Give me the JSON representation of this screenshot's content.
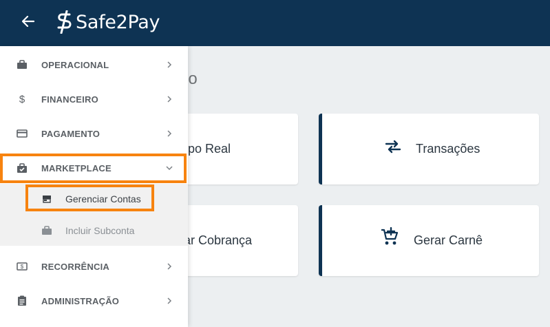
{
  "app": {
    "logo_text": "Safe2Pay"
  },
  "page": {
    "title_fragment": "do"
  },
  "cards": [
    {
      "label": "mpo Real",
      "icon": "clock-icon"
    },
    {
      "label": "Transações",
      "icon": "swap-arrows-icon"
    },
    {
      "label": "zar Cobrança",
      "icon": "invoice-icon"
    },
    {
      "label": "Gerar Carnê",
      "icon": "add-cart-icon"
    }
  ],
  "menu": {
    "items": [
      {
        "label": "OPERACIONAL",
        "icon": "briefcase-icon"
      },
      {
        "label": "FINANCEIRO",
        "icon": "dollar-icon"
      },
      {
        "label": "PAGAMENTO",
        "icon": "credit-card-icon"
      },
      {
        "label": "MARKETPLACE",
        "icon": "shopping-bag-check-icon",
        "expanded": true
      },
      {
        "label": "RECORRÊNCIA",
        "icon": "money-icon"
      },
      {
        "label": "ADMINISTRAÇÃO",
        "icon": "clipboard-icon"
      }
    ],
    "submenu": [
      {
        "label": "Gerenciar Contas",
        "icon": "store-icon"
      },
      {
        "label": "Incluir Subconta",
        "icon": "briefcase-icon"
      }
    ]
  },
  "colors": {
    "header": "#0e3353",
    "highlight": "#f7830f",
    "card_accent": "#0e3353"
  }
}
